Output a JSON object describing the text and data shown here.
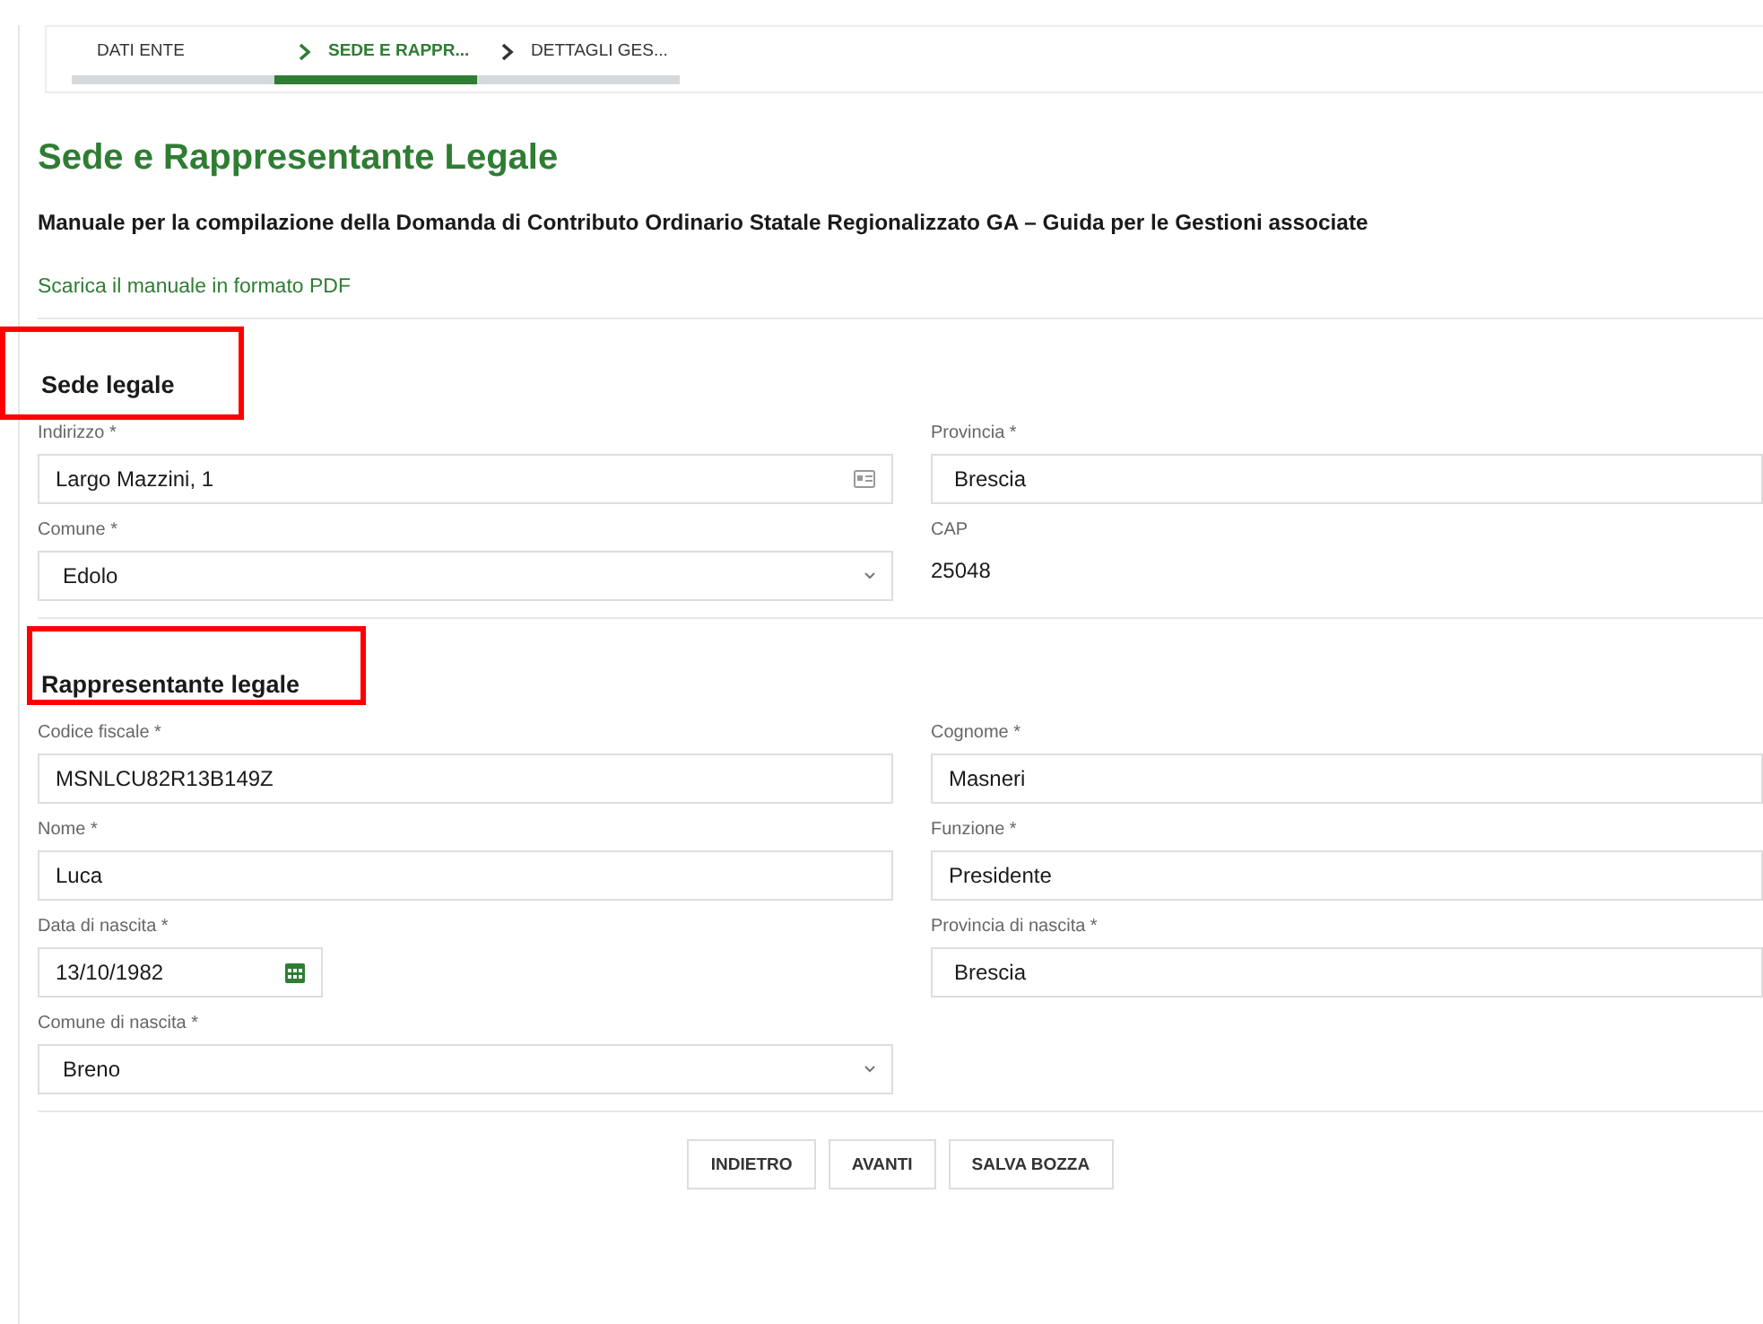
{
  "steps": [
    {
      "label": "DATI ENTE",
      "selected": false
    },
    {
      "label": "SEDE E RAPPR...",
      "selected": true
    },
    {
      "label": "DETTAGLI GES...",
      "selected": false
    }
  ],
  "title": "Sede e Rappresentante Legale",
  "subtitle": "Manuale per la compilazione della Domanda di Contributo Ordinario Statale Regionalizzato GA – Guida per le Gestioni associate",
  "manual_link": "Scarica il manuale in formato PDF",
  "sections": [
    {
      "heading": "Sede legale",
      "highlighted": true,
      "fields": [
        {
          "label": "Indirizzo *",
          "value": "Largo Mazzini, 1",
          "kind": "address"
        },
        {
          "label": "Provincia *",
          "value": "Brescia",
          "kind": "select-cut"
        },
        {
          "label": "Comune *",
          "value": "Edolo",
          "kind": "select"
        },
        {
          "label": "CAP",
          "value": "25048",
          "kind": "static"
        }
      ]
    },
    {
      "heading": "Rappresentante legale",
      "highlighted": true,
      "fields": [
        {
          "label": "Codice fiscale *",
          "value": "MSNLCU82R13B149Z",
          "kind": "text"
        },
        {
          "label": "Cognome *",
          "value": "Masneri",
          "kind": "text"
        },
        {
          "label": "Nome *",
          "value": "Luca",
          "kind": "text"
        },
        {
          "label": "Funzione *",
          "value": "Presidente",
          "kind": "text"
        },
        {
          "label": "Data di nascita *",
          "value": "13/10/1982",
          "kind": "date"
        },
        {
          "label": "Provincia di nascita *",
          "value": "Brescia",
          "kind": "select-cut"
        },
        {
          "label": "Comune di nascita *",
          "value": "Breno",
          "kind": "select"
        }
      ]
    }
  ],
  "buttons": [
    "INDIETRO",
    "AVANTI",
    "SALVA BOZZA"
  ]
}
